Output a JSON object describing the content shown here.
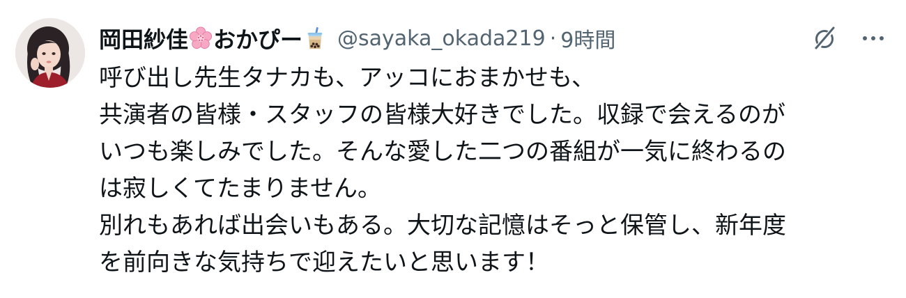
{
  "tweet": {
    "author": {
      "display_name_part1": "岡田紗佳",
      "display_name_part2": "おかぴー",
      "emoji_1": "cherry-blossom-emoji",
      "emoji_2": "bubble-tea-emoji",
      "handle": "@sayaka_okada219",
      "separator": "·",
      "time": "9時間"
    },
    "icons": {
      "grok": "grok-icon",
      "more": "more-options-icon"
    },
    "text_lines": [
      "呼び出し先生タナカも、アッコにおまかせも、",
      "共演者の皆様・スタッフの皆様大好きでした。収録で会えるのが",
      "いつも楽しみでした。そんな愛した二つの番組が一気に終わるの",
      "は寂しくてたまりません。",
      "別れもあれば出会いもある。大切な記憶はそっと保管し、新年度",
      "を前向きな気持ちで迎えたいと思います！"
    ]
  }
}
